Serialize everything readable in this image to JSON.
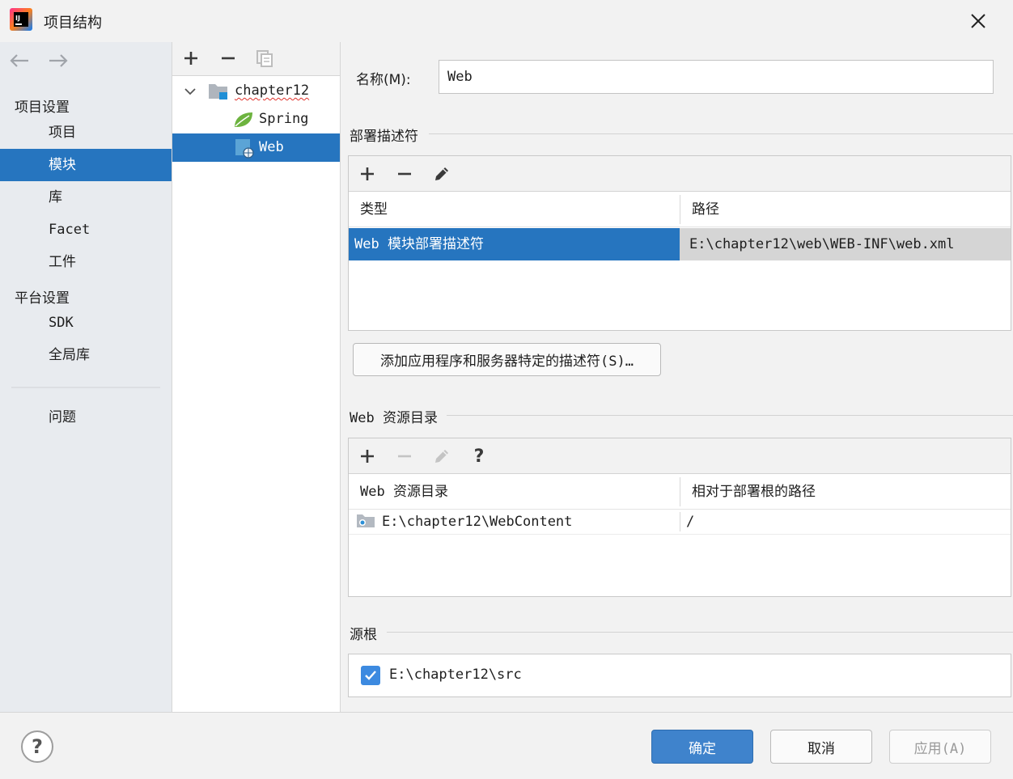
{
  "window": {
    "title": "项目结构",
    "close_icon": "close-icon"
  },
  "nav": {
    "back_icon": "arrow-left-icon",
    "forward_icon": "arrow-right-icon",
    "section_project": "项目设置",
    "items_project": [
      "项目",
      "模块",
      "库",
      "Facet",
      "工件"
    ],
    "section_platform": "平台设置",
    "items_platform": [
      "SDK",
      "全局库"
    ],
    "problems": "问题",
    "selected": "模块"
  },
  "tree": {
    "toolbar": [
      "add-icon",
      "remove-icon",
      "copy-icon"
    ],
    "root": "chapter12",
    "children": [
      "Spring",
      "Web"
    ],
    "selected": "Web"
  },
  "name_field": {
    "label": "名称(M):",
    "value": "Web"
  },
  "deployment": {
    "section_title": "部署描述符",
    "columns": [
      "类型",
      "路径"
    ],
    "rows": [
      {
        "type": "Web 模块部署描述符",
        "path": "E:\\chapter12\\web\\WEB-INF\\web.xml"
      }
    ],
    "add_button": "添加应用程序和服务器特定的描述符(S)…"
  },
  "web_resources": {
    "section_title": "Web 资源目录",
    "columns": [
      "Web 资源目录",
      "相对于部署根的路径"
    ],
    "rows": [
      {
        "dir": "E:\\chapter12\\WebContent",
        "relative": "/"
      }
    ],
    "help_glyph": "?"
  },
  "source_roots": {
    "section_title": "源根",
    "items": [
      {
        "path": "E:\\chapter12\\src",
        "checked": true
      }
    ]
  },
  "buttons": {
    "ok": "确定",
    "cancel": "取消",
    "apply": "应用(A)",
    "help_glyph": "?"
  },
  "colors": {
    "selection": "#2675bf",
    "primary_button": "#3f83cc",
    "spring_leaf": "#6db33f"
  }
}
